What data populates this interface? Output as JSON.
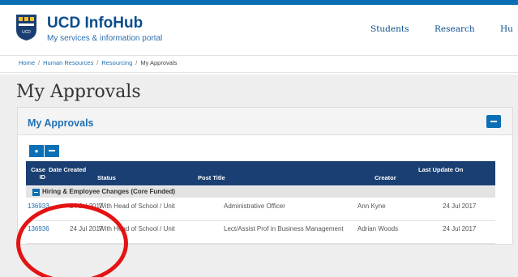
{
  "header": {
    "title": "UCD InfoHub",
    "subtitle": "My services & information portal",
    "logo_icon": "ucd-crest-icon",
    "nav": [
      "Students",
      "Research",
      "Hu"
    ]
  },
  "breadcrumb": {
    "items": [
      "Home",
      "Human Resources",
      "Resourcing",
      "My Approvals"
    ],
    "separator": "/"
  },
  "page": {
    "title": "My Approvals"
  },
  "panel": {
    "title": "My Approvals",
    "collapse_icon": "minus-icon",
    "expand_all_icon": "plus-icon",
    "collapse_all_icon": "minus-icon"
  },
  "table": {
    "columns": [
      "Case ID",
      "Date Created",
      "Status",
      "Post Title",
      "Creator",
      "Last Update On"
    ],
    "group": {
      "label": "Hiring & Employee Changes (Core Funded)"
    },
    "rows": [
      {
        "case_id": "136933",
        "date_created": "24 Jul 2017",
        "status": "With Head of School / Unit",
        "post_title": "Administrative Officer",
        "creator": "Ann Kyne",
        "last_update": "24 Jul 2017"
      },
      {
        "case_id": "136936",
        "date_created": "24 Jul 2017",
        "status": "With Head of School / Unit",
        "post_title": "Lect/Assist Prof in Business Management",
        "creator": "Adrian Woods",
        "last_update": "24 Jul 2017"
      }
    ]
  },
  "colors": {
    "brand": "#0b4d8c",
    "accent": "#0b6fb6",
    "table_header": "#1a3f72",
    "annotation": "#e41313"
  }
}
